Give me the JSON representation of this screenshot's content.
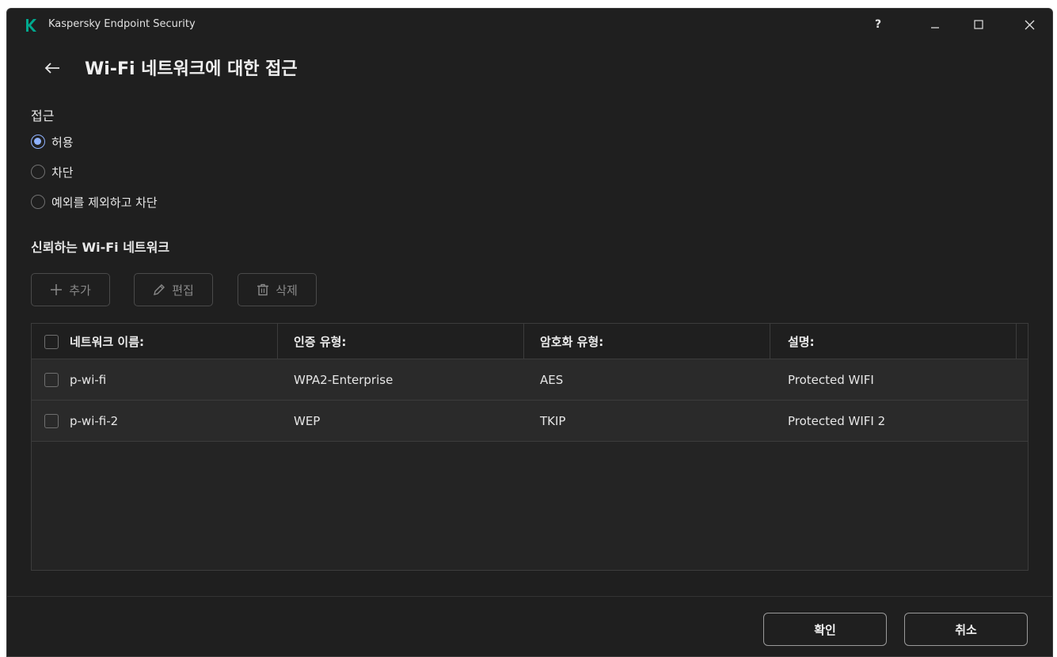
{
  "window": {
    "app_title": "Kaspersky Endpoint Security",
    "help_label": "?"
  },
  "page": {
    "title": "Wi-Fi 네트워크에 대한 접근"
  },
  "access": {
    "label": "접근",
    "options": [
      {
        "label": "허용",
        "selected": true
      },
      {
        "label": "차단",
        "selected": false
      },
      {
        "label": "예외를 제외하고 차단",
        "selected": false
      }
    ]
  },
  "trusted": {
    "label": "신뢰하는 Wi-Fi 네트워크"
  },
  "toolbar": {
    "add_label": "추가",
    "edit_label": "편집",
    "delete_label": "삭제"
  },
  "table": {
    "columns": [
      "네트워크 이름:",
      "인증 유형:",
      "암호화 유형:",
      "설명:"
    ],
    "rows": [
      {
        "name": "p-wi-fi",
        "auth": "WPA2-Enterprise",
        "encryption": "AES",
        "description": "Protected WIFI"
      },
      {
        "name": "p-wi-fi-2",
        "auth": "WEP",
        "encryption": "TKIP",
        "description": "Protected WIFI 2"
      }
    ]
  },
  "footer": {
    "ok_label": "확인",
    "cancel_label": "취소"
  },
  "colors": {
    "background": "#1f1f1f",
    "accent": "#8fb2ff",
    "brand": "#00a88e"
  }
}
